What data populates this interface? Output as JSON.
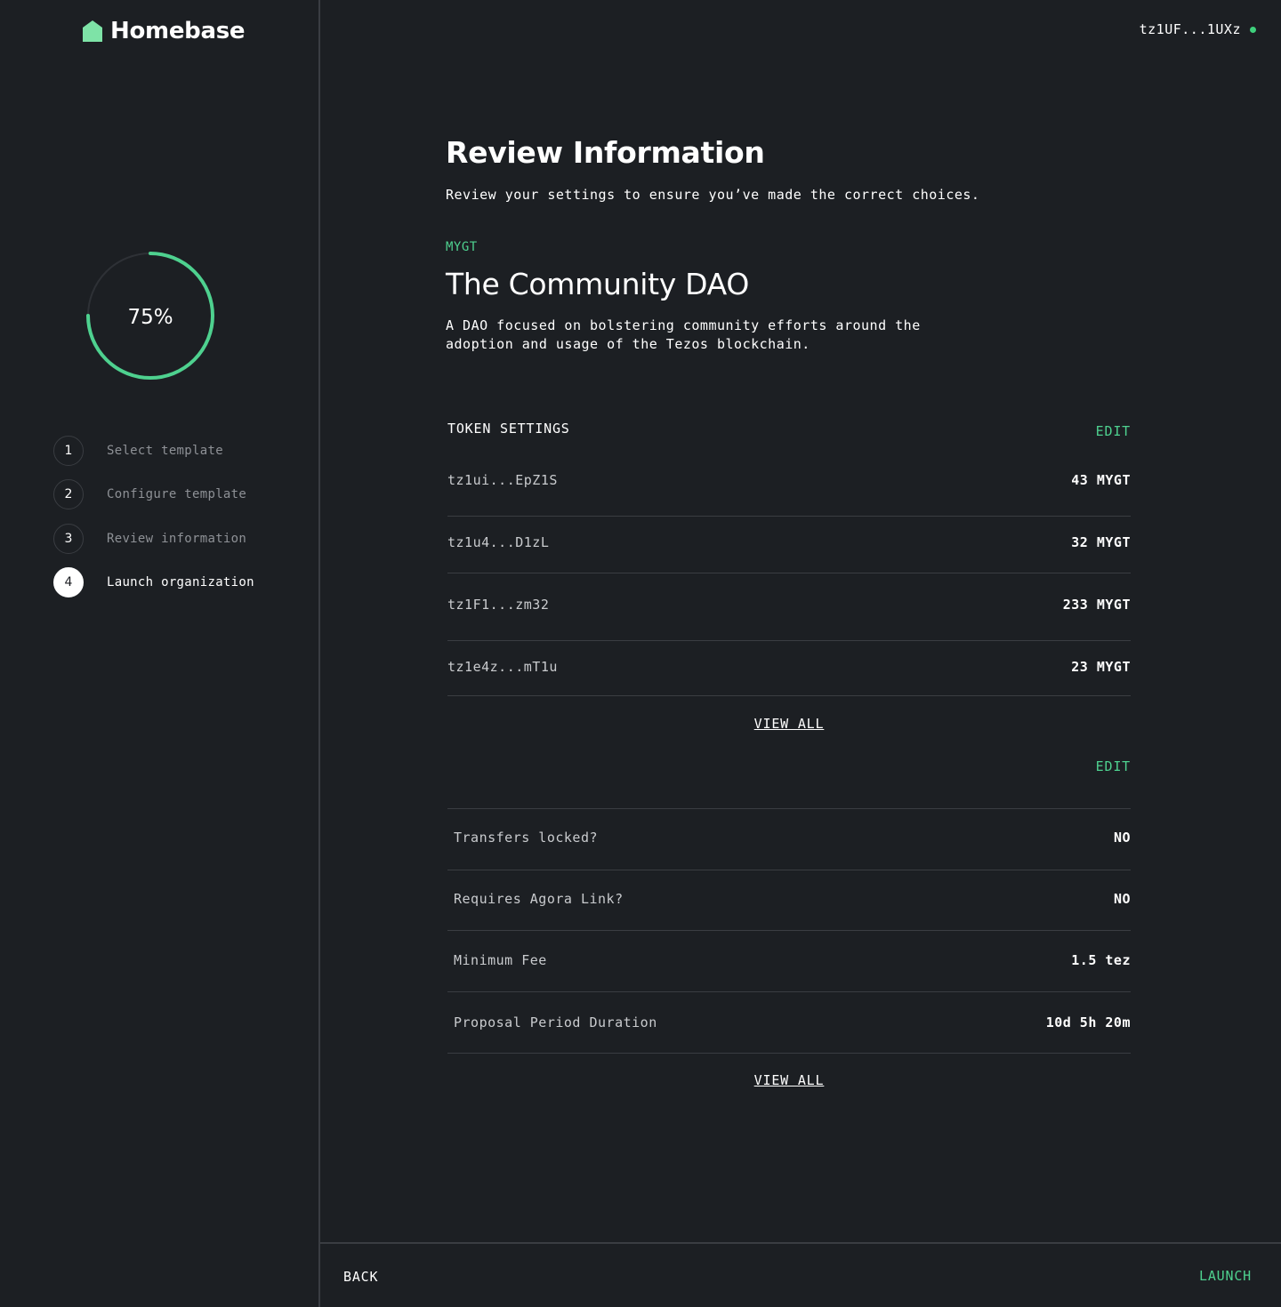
{
  "brand": {
    "name": "Homebase",
    "accent_color": "#4ed18f",
    "icon": "home-icon"
  },
  "wallet": {
    "address": "tz1UF...1UXz",
    "status_color": "#3ed07c"
  },
  "progress": {
    "percent": 75,
    "label": "75%"
  },
  "steps": [
    {
      "number": "1",
      "label": "Select template",
      "active": false
    },
    {
      "number": "2",
      "label": "Configure template",
      "active": false
    },
    {
      "number": "3",
      "label": "Review information",
      "active": false
    },
    {
      "number": "4",
      "label": "Launch organization",
      "active": true
    }
  ],
  "review": {
    "title": "Review Information",
    "subtitle": "Review your settings to ensure you’ve made the correct choices."
  },
  "dao": {
    "symbol": "MYGT",
    "name": "The Community DAO",
    "description": "A DAO focused on bolstering community efforts around the adoption and usage of the Tezos blockchain."
  },
  "token_settings": {
    "title": "TOKEN SETTINGS",
    "edit_label": "EDIT",
    "holders": [
      {
        "address": "tz1ui...EpZ1S",
        "amount": "43 MYGT"
      },
      {
        "address": "tz1u4...D1zL",
        "amount": "32 MYGT"
      },
      {
        "address": "tz1F1...zm32",
        "amount": "233 MYGT"
      },
      {
        "address": "tz1e4z...mT1u",
        "amount": "23 MYGT"
      }
    ],
    "view_all_label": "VIEW ALL"
  },
  "governance_settings": {
    "edit_label": "EDIT",
    "items": [
      {
        "label": "Transfers locked?",
        "value": "NO"
      },
      {
        "label": "Requires Agora Link?",
        "value": "NO"
      },
      {
        "label": "Minimum Fee",
        "value": "1.5 tez"
      },
      {
        "label": "Proposal Period Duration",
        "value": "10d 5h 20m"
      }
    ],
    "view_all_label": "VIEW ALL"
  },
  "footer": {
    "back_label": "BACK",
    "launch_label": "LAUNCH"
  }
}
